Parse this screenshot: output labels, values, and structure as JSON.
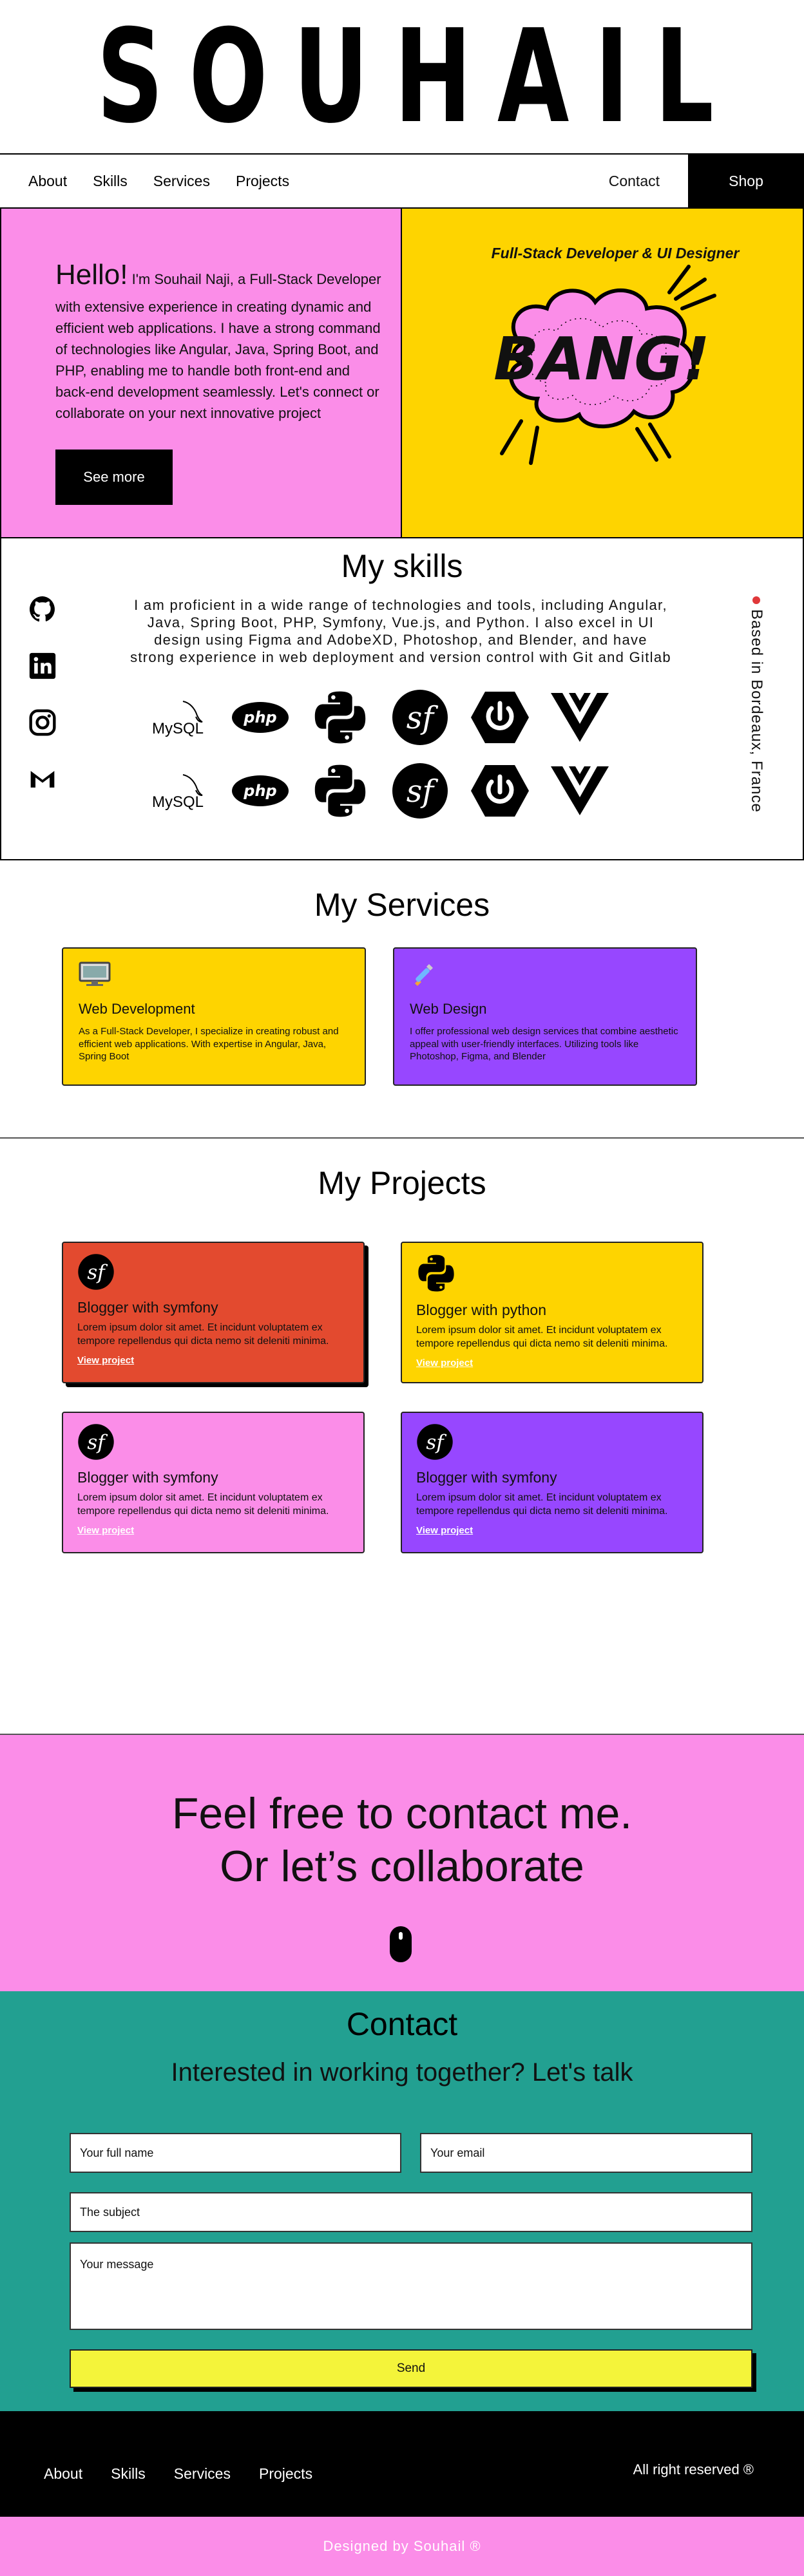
{
  "brand": {
    "logo": "SOUHAIL"
  },
  "nav": {
    "links": [
      "About",
      "Skills",
      "Services",
      "Projects"
    ],
    "contact": "Contact",
    "shop": "Shop"
  },
  "hero": {
    "hello": "Hello!",
    "intro": " I'm Souhail Naji, a Full-Stack Developer with extensive experience in creating dynamic and efficient web applications. I have a strong command of technologies like Angular, Java, Spring Boot, and PHP, enabling me to handle both front-end and back-end development seamlessly. Let's connect or collaborate on your next innovative project",
    "button": "See more",
    "tagline": "Full-Stack Developer & UI Designer",
    "bang": "BANG!"
  },
  "skills": {
    "title": "My skills",
    "text": "I am proficient in a wide range of technologies and tools, including Angular, Java, Spring Boot, PHP, Symfony, Vue.js, and Python. I also excel in UI design using Figma and AdobeXD, Photoshop, and Blender, and have strong experience in web deployment and version control with Git and Gitlab",
    "location": "Based in Bordeaux, France",
    "socials": [
      "github-icon",
      "linkedin-icon",
      "instagram-icon",
      "gmail-icon"
    ],
    "tech": [
      "mysql-icon",
      "php-icon",
      "python-icon",
      "symfony-icon",
      "power-icon",
      "vue-icon"
    ],
    "mysql_label": "MySQL",
    "php_label": "php"
  },
  "services": {
    "title": "My Services",
    "items": [
      {
        "title": "Web Development",
        "desc": "As a Full-Stack Developer, I specialize in creating robust and efficient web applications. With expertise in Angular, Java, Spring Boot",
        "icon": "monitor-icon",
        "color": "#fed400"
      },
      {
        "title": "Web Design",
        "desc": "I offer professional web design services that combine aesthetic appeal with user-friendly interfaces. Utilizing tools like Photoshop, Figma, and Blender",
        "icon": "brush-icon",
        "color": "#9747ff"
      }
    ]
  },
  "projects": {
    "title": "My Projects",
    "items": [
      {
        "title": "Blogger with symfony",
        "desc": "Lorem ipsum dolor sit amet. Et incidunt voluptatem ex tempore repellendus qui dicta nemo sit deleniti minima.",
        "link": "View project",
        "icon": "symfony-icon",
        "color": "#e34a2f"
      },
      {
        "title": "Blogger with python",
        "desc": "Lorem ipsum dolor sit amet. Et incidunt voluptatem ex tempore repellendus qui dicta nemo sit deleniti minima.",
        "link": "View project",
        "icon": "python-icon",
        "color": "#fed400"
      },
      {
        "title": "Blogger with symfony",
        "desc": "Lorem ipsum dolor sit amet. Et incidunt voluptatem ex tempore repellendus qui dicta nemo sit deleniti minima.",
        "link": "View project",
        "icon": "symfony-icon",
        "color": "#fb8de8"
      },
      {
        "title": "Blogger with symfony",
        "desc": "Lorem ipsum dolor sit amet. Et incidunt voluptatem ex tempore repellendus qui dicta nemo sit deleniti minima.",
        "link": "View project",
        "icon": "symfony-icon",
        "color": "#9747ff"
      }
    ]
  },
  "collab": {
    "line1": "Feel free to contact me.",
    "line2": "Or let’s collaborate"
  },
  "contact": {
    "title": "Contact",
    "subtitle": "Interested in working together? Let's talk",
    "name_placeholder": "Your full name",
    "email_placeholder": "Your email",
    "subject_placeholder": "The subject",
    "message_placeholder": "Your message",
    "send": "Send"
  },
  "footer": {
    "links": [
      "About",
      "Skills",
      "Services",
      "Projects"
    ],
    "rights": "All right reserved ®",
    "designed": "Designed by Souhail ®"
  }
}
